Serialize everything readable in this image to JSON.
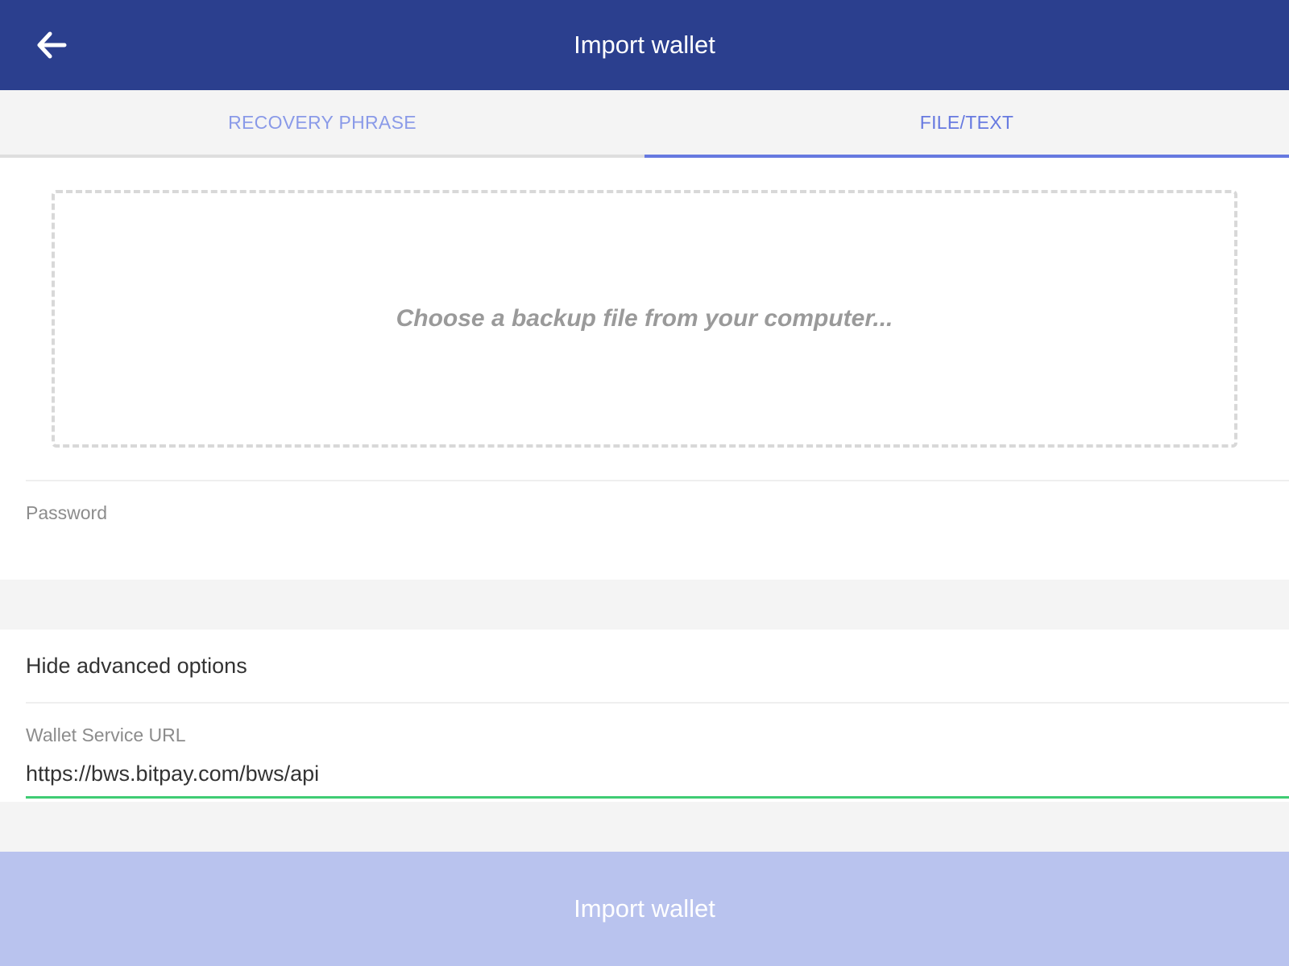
{
  "header": {
    "title": "Import wallet",
    "back_icon": "arrow-left-icon"
  },
  "tabs": [
    {
      "label": "RECOVERY PHRASE",
      "active": false
    },
    {
      "label": "FILE/TEXT",
      "active": true
    }
  ],
  "file_section": {
    "dropzone_text": "Choose a backup file from your computer...",
    "password_label": "Password",
    "password_value": ""
  },
  "advanced": {
    "toggle_label": "Hide advanced options",
    "bws_label": "Wallet Service URL",
    "bws_value": "https://bws.bitpay.com/bws/api"
  },
  "footer": {
    "import_label": "Import wallet"
  },
  "colors": {
    "header_bg": "#2b3f8e",
    "tab_active": "#6679e0",
    "tab_inactive": "#8a9ae8",
    "input_focus": "#3fcc73",
    "button_disabled": "#b9c3ee"
  }
}
